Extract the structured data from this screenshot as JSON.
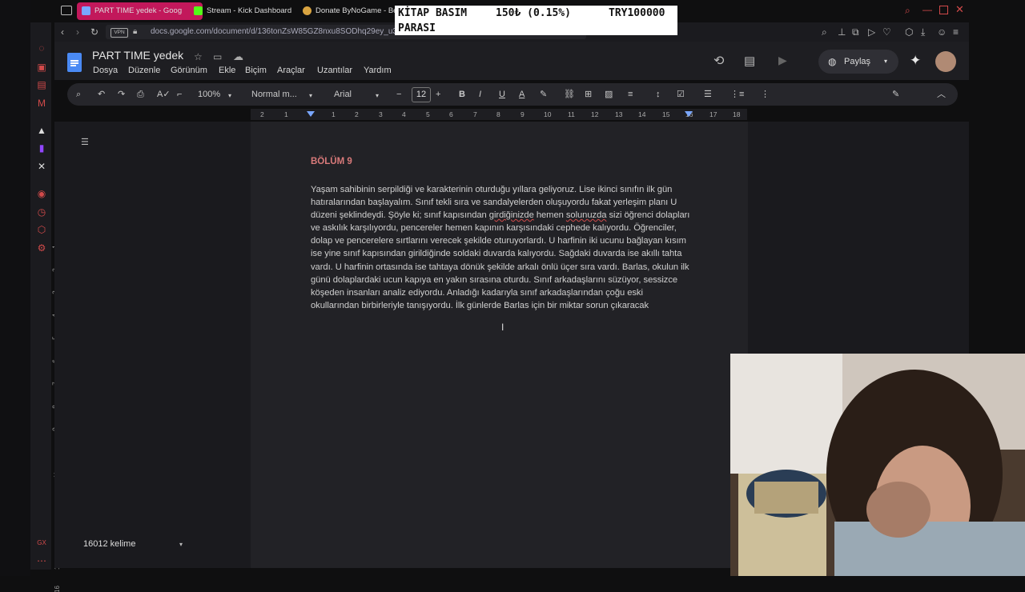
{
  "tabs": [
    {
      "title": "PART TIME yedek - Goog",
      "active": true,
      "color": "#c2185b"
    },
    {
      "title": "Stream - Kick Dashboard",
      "active": false,
      "color": "#53fc18"
    },
    {
      "title": "Donate ByNoGame - Be",
      "active": false,
      "color": "#d9a441"
    }
  ],
  "address": {
    "vpn": "VPN",
    "url": "docs.google.com/document/d/136tonZsW85GZ8nxu8SODhq29ey_u3"
  },
  "overlay": {
    "line1_label": "KİTAP BASIM",
    "amount": "150₺ (0.15%)",
    "target": "TRY100000",
    "line2_label": "PARASI"
  },
  "doc": {
    "title": "PART TIME yedek",
    "menu": [
      "Dosya",
      "Düzenle",
      "Görünüm",
      "Ekle",
      "Biçim",
      "Araçlar",
      "Uzantılar",
      "Yardım"
    ],
    "share_label": "Paylaş",
    "toolbar": {
      "zoom": "100%",
      "style": "Normal m...",
      "font": "Arial",
      "font_size": "12"
    },
    "ruler_ticks": [
      "2",
      "1",
      "1",
      "2",
      "3",
      "4",
      "5",
      "6",
      "7",
      "8",
      "9",
      "10",
      "11",
      "12",
      "13",
      "14",
      "15",
      "16",
      "17",
      "18"
    ],
    "vruler_ticks": [
      "1",
      "2",
      "3",
      "4",
      "5",
      "6",
      "7",
      "8",
      "9",
      "10",
      "11",
      "12",
      "13",
      "14",
      "15",
      "16"
    ],
    "heading": "BÖLÜM 9",
    "body_parts": [
      "Yaşam sahibinin serpildiği ve karakterinin oturduğu yıllara geliyoruz. Lise ikinci sınıfın ilk gün hatıralarından başlayalım. Sınıf tekli sıra ve sandalyelerden oluşuyordu fakat yerleşim planı U düzeni şeklindeydi. Şöyle ki; sınıf kapısından ",
      "girdiğinizde",
      " hemen ",
      "solunuzda",
      " sizi öğrenci dolapları ve askılık karşılıyordu, pencereler hemen kapının karşısındaki cephede kalıyordu. Öğrenciler, dolap ve pencerelere sırtlarını verecek şekilde oturuyorlardı. U harfinin iki ucunu bağlayan kısım ise yine sınıf kapısından girildiğinde soldaki duvarda kalıyordu. Sağdaki duvarda ise akıllı tahta vardı. U harfinin ortasında ise tahtaya dönük şekilde arkalı önlü üçer sıra vardı. Barlas, okulun ilk günü dolaplardaki ucun kapıya en yakın sırasına oturdu. Sınıf arkadaşlarını süzüyor, sessizce köşeden insanları analiz ediyordu. Anladığı kadarıyla sınıf arkadaşlarından çoğu eski okullarından birbirleriyle tanışıyordu. İlk günlerde Barlas için bir miktar sorun çıkaracak"
    ],
    "word_count": "16012 kelime"
  }
}
